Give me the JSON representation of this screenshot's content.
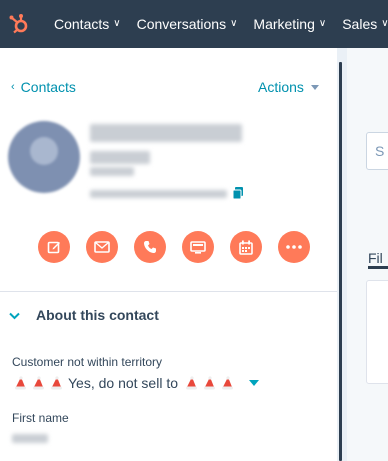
{
  "topnav": {
    "items": [
      {
        "label": "Contacts"
      },
      {
        "label": "Conversations"
      },
      {
        "label": "Marketing"
      },
      {
        "label": "Sales"
      }
    ]
  },
  "header": {
    "back_label": "Contacts",
    "actions_label": "Actions"
  },
  "action_buttons": [
    {
      "name": "note-button",
      "icon": "edit-icon"
    },
    {
      "name": "email-button",
      "icon": "envelope-icon"
    },
    {
      "name": "call-button",
      "icon": "phone-icon"
    },
    {
      "name": "log-activity-button",
      "icon": "screen-icon"
    },
    {
      "name": "meeting-button",
      "icon": "calendar-icon"
    },
    {
      "name": "more-button",
      "icon": "more-icon"
    }
  ],
  "about": {
    "title": "About this contact"
  },
  "properties": [
    {
      "label": "Customer not within territory",
      "value": "Yes, do not sell to"
    },
    {
      "label": "First name",
      "value": ""
    }
  ],
  "right_panel": {
    "search_placeholder": "S",
    "filter_label": "Fil"
  },
  "colors": {
    "nav_bg": "#2d3e50",
    "accent": "#ff7a59",
    "link": "#0091ae"
  }
}
